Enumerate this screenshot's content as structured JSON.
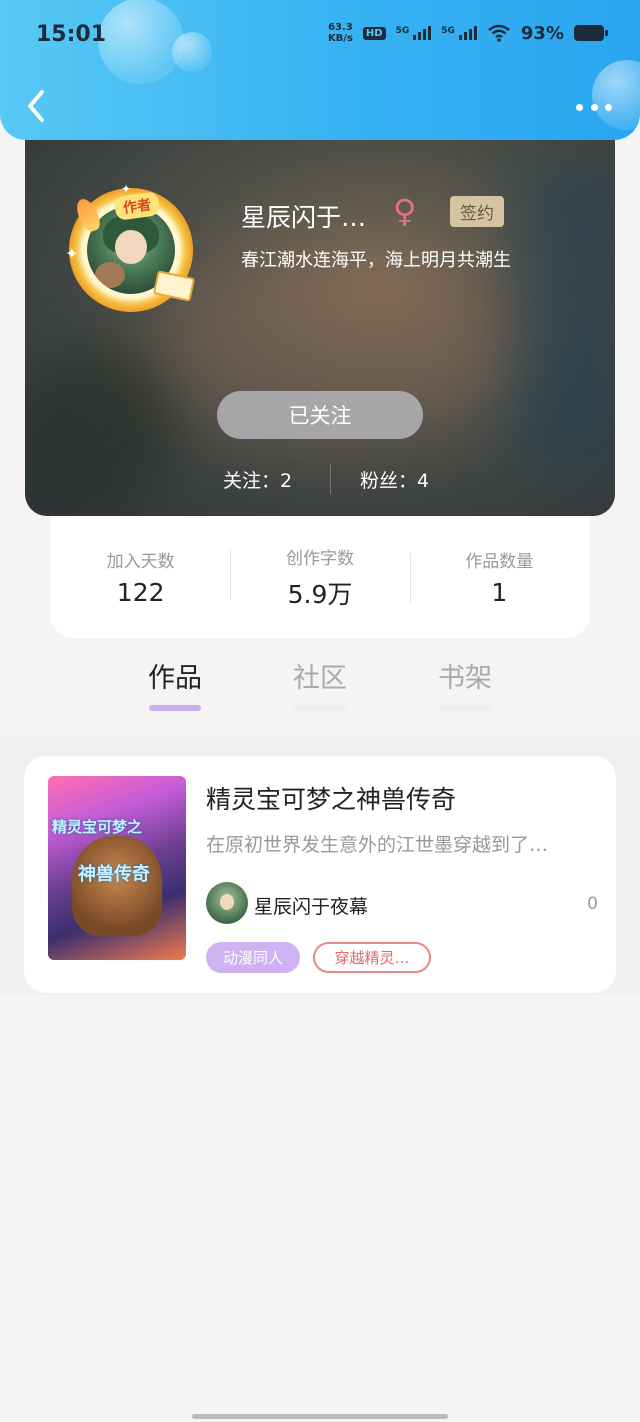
{
  "status_bar": {
    "time": "15:01",
    "net_speed_value": "63.3",
    "net_speed_unit": "KB/s",
    "hd_label": "HD",
    "signal_1_label": "5G",
    "signal_2_label": "5G",
    "battery_percent": "93%"
  },
  "header": {
    "back_icon": "chevron-left-icon",
    "more_icon": "more-horizontal-icon",
    "accent_color": "#37b2f2"
  },
  "profile": {
    "author_tag": "作者",
    "name": "星辰闪于…",
    "gender_symbol": "♀",
    "signed_badge": "签约",
    "motto": "春江潮水连海平，海上明月共潮生",
    "follow_button": "已关注",
    "following": "关注：2",
    "fans": "粉丝：4"
  },
  "stats": [
    {
      "label": "加入天数",
      "value": "122"
    },
    {
      "label": "创作字数",
      "value": "5.9万"
    },
    {
      "label": "作品数量",
      "value": "1"
    }
  ],
  "tabs": [
    {
      "label": "作品",
      "active": true
    },
    {
      "label": "社区",
      "active": false
    },
    {
      "label": "书架",
      "active": false
    }
  ],
  "works": [
    {
      "cover_text_line1": "精灵宝可梦之",
      "cover_text_line2": "神兽传奇",
      "title": "精灵宝可梦之神兽传奇",
      "description": "在原初世界发生意外的江世墨穿越到了…",
      "author": "星辰闪于夜幕",
      "count": "0",
      "tag_primary": "动漫同人",
      "tag_secondary": "穿越精灵…"
    }
  ]
}
